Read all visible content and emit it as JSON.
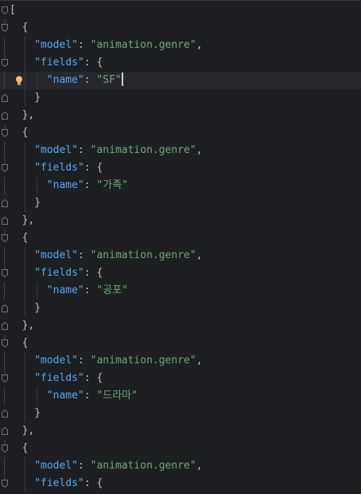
{
  "editor": {
    "lines": [
      {
        "indent": 0,
        "parts": [
          {
            "t": "punc",
            "v": "["
          }
        ]
      },
      {
        "indent": 1,
        "parts": [
          {
            "t": "punc",
            "v": "{"
          }
        ]
      },
      {
        "indent": 2,
        "parts": [
          {
            "t": "key",
            "v": "\"model\""
          },
          {
            "t": "punc",
            "v": ": "
          },
          {
            "t": "str",
            "v": "\"animation.genre\""
          },
          {
            "t": "punc",
            "v": ","
          }
        ]
      },
      {
        "indent": 2,
        "parts": [
          {
            "t": "key",
            "v": "\"fields\""
          },
          {
            "t": "punc",
            "v": ": {"
          }
        ]
      },
      {
        "indent": 3,
        "parts": [
          {
            "t": "key",
            "v": "\"name\""
          },
          {
            "t": "punc",
            "v": ": "
          },
          {
            "t": "str",
            "v": "\"SF\""
          }
        ],
        "current": true
      },
      {
        "indent": 2,
        "parts": [
          {
            "t": "punc",
            "v": "}"
          }
        ]
      },
      {
        "indent": 1,
        "parts": [
          {
            "t": "punc",
            "v": "},"
          }
        ]
      },
      {
        "indent": 1,
        "parts": [
          {
            "t": "punc",
            "v": "{"
          }
        ]
      },
      {
        "indent": 2,
        "parts": [
          {
            "t": "key",
            "v": "\"model\""
          },
          {
            "t": "punc",
            "v": ": "
          },
          {
            "t": "str",
            "v": "\"animation.genre\""
          },
          {
            "t": "punc",
            "v": ","
          }
        ]
      },
      {
        "indent": 2,
        "parts": [
          {
            "t": "key",
            "v": "\"fields\""
          },
          {
            "t": "punc",
            "v": ": {"
          }
        ]
      },
      {
        "indent": 3,
        "parts": [
          {
            "t": "key",
            "v": "\"name\""
          },
          {
            "t": "punc",
            "v": ": "
          },
          {
            "t": "str",
            "v": "\"가족\""
          }
        ]
      },
      {
        "indent": 2,
        "parts": [
          {
            "t": "punc",
            "v": "}"
          }
        ]
      },
      {
        "indent": 1,
        "parts": [
          {
            "t": "punc",
            "v": "},"
          }
        ]
      },
      {
        "indent": 1,
        "parts": [
          {
            "t": "punc",
            "v": "{"
          }
        ]
      },
      {
        "indent": 2,
        "parts": [
          {
            "t": "key",
            "v": "\"model\""
          },
          {
            "t": "punc",
            "v": ": "
          },
          {
            "t": "str",
            "v": "\"animation.genre\""
          },
          {
            "t": "punc",
            "v": ","
          }
        ]
      },
      {
        "indent": 2,
        "parts": [
          {
            "t": "key",
            "v": "\"fields\""
          },
          {
            "t": "punc",
            "v": ": {"
          }
        ]
      },
      {
        "indent": 3,
        "parts": [
          {
            "t": "key",
            "v": "\"name\""
          },
          {
            "t": "punc",
            "v": ": "
          },
          {
            "t": "str",
            "v": "\"공포\""
          }
        ]
      },
      {
        "indent": 2,
        "parts": [
          {
            "t": "punc",
            "v": "}"
          }
        ]
      },
      {
        "indent": 1,
        "parts": [
          {
            "t": "punc",
            "v": "},"
          }
        ]
      },
      {
        "indent": 1,
        "parts": [
          {
            "t": "punc",
            "v": "{"
          }
        ]
      },
      {
        "indent": 2,
        "parts": [
          {
            "t": "key",
            "v": "\"model\""
          },
          {
            "t": "punc",
            "v": ": "
          },
          {
            "t": "str",
            "v": "\"animation.genre\""
          },
          {
            "t": "punc",
            "v": ","
          }
        ]
      },
      {
        "indent": 2,
        "parts": [
          {
            "t": "key",
            "v": "\"fields\""
          },
          {
            "t": "punc",
            "v": ": {"
          }
        ]
      },
      {
        "indent": 3,
        "parts": [
          {
            "t": "key",
            "v": "\"name\""
          },
          {
            "t": "punc",
            "v": ": "
          },
          {
            "t": "str",
            "v": "\"드라마\""
          }
        ]
      },
      {
        "indent": 2,
        "parts": [
          {
            "t": "punc",
            "v": "}"
          }
        ]
      },
      {
        "indent": 1,
        "parts": [
          {
            "t": "punc",
            "v": "},"
          }
        ]
      },
      {
        "indent": 1,
        "parts": [
          {
            "t": "punc",
            "v": "{"
          }
        ]
      },
      {
        "indent": 2,
        "parts": [
          {
            "t": "key",
            "v": "\"model\""
          },
          {
            "t": "punc",
            "v": ": "
          },
          {
            "t": "str",
            "v": "\"animation.genre\""
          },
          {
            "t": "punc",
            "v": ","
          }
        ]
      },
      {
        "indent": 2,
        "parts": [
          {
            "t": "key",
            "v": "\"fields\""
          },
          {
            "t": "punc",
            "v": ": {"
          }
        ]
      }
    ],
    "folds": [
      {
        "line": 0,
        "dir": "open"
      },
      {
        "line": 1,
        "dir": "open"
      },
      {
        "line": 3,
        "dir": "open"
      },
      {
        "line": 5,
        "dir": "close"
      },
      {
        "line": 6,
        "dir": "close"
      },
      {
        "line": 7,
        "dir": "open"
      },
      {
        "line": 9,
        "dir": "open"
      },
      {
        "line": 11,
        "dir": "close"
      },
      {
        "line": 12,
        "dir": "close"
      },
      {
        "line": 13,
        "dir": "open"
      },
      {
        "line": 15,
        "dir": "open"
      },
      {
        "line": 17,
        "dir": "close"
      },
      {
        "line": 18,
        "dir": "close"
      },
      {
        "line": 19,
        "dir": "open"
      },
      {
        "line": 21,
        "dir": "open"
      },
      {
        "line": 23,
        "dir": "close"
      },
      {
        "line": 24,
        "dir": "close"
      },
      {
        "line": 25,
        "dir": "open"
      },
      {
        "line": 27,
        "dir": "open"
      }
    ],
    "colors": {
      "background": "#1e1f22",
      "key": "#56a8f5",
      "string": "#6aab73",
      "punctuation": "#bcbec4",
      "current_line": "#26282e",
      "bulb": "#f2c55c"
    },
    "bulb_icon": "lightbulb-icon",
    "bulb_line": 4
  }
}
